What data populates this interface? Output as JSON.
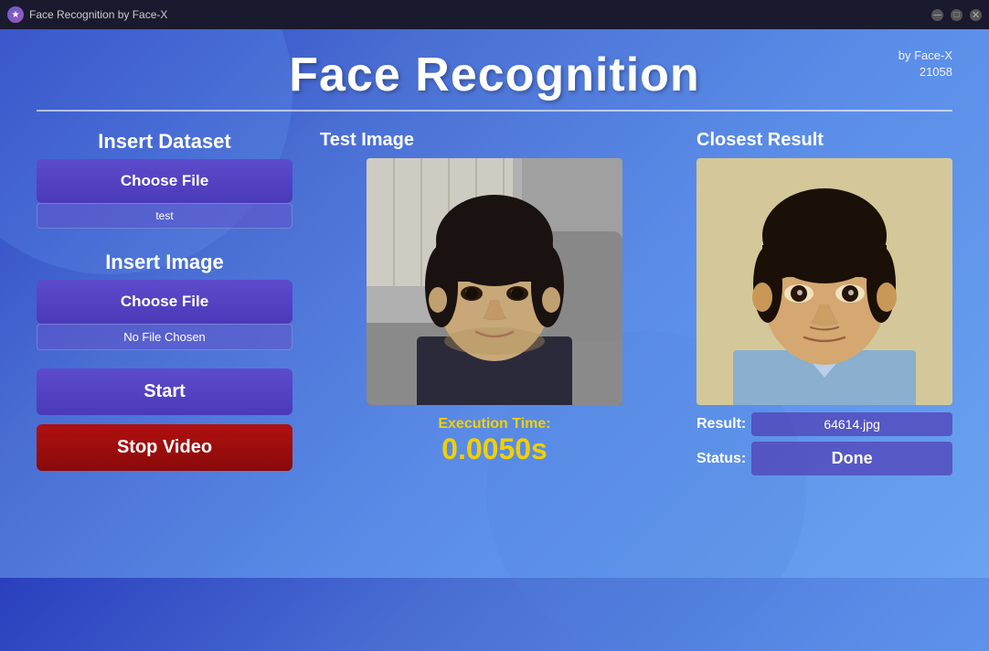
{
  "titleBar": {
    "appName": "Face Recognition by Face-X",
    "controls": [
      "minimize",
      "maximize",
      "close"
    ]
  },
  "header": {
    "title": "Face Recognition",
    "byLine": "by Face-X",
    "version": "21058"
  },
  "leftPanel": {
    "datasetSection": "Insert Dataset",
    "chooseFileDataset": "Choose File",
    "datasetFileName": "test",
    "imageSection": "Insert Image",
    "chooseFileImage": "Choose File",
    "noFileChosen": "No File Chosen",
    "startButton": "Start",
    "stopButton": "Stop Video"
  },
  "middlePanel": {
    "testImageLabel": "Test Image",
    "executionTimeLabel": "Execution Time:",
    "executionTimeValue": "0.0050s"
  },
  "rightPanel": {
    "closestResultLabel": "Closest Result",
    "resultLabel": "Result:",
    "resultFileName": "64614.jpg",
    "statusLabel": "Status:",
    "statusValue": "Done"
  },
  "colors": {
    "background": "#3a5bd9",
    "buttonPurple": "#5c4ccc",
    "buttonRed": "#b01010",
    "executionYellow": "#f0d000"
  }
}
